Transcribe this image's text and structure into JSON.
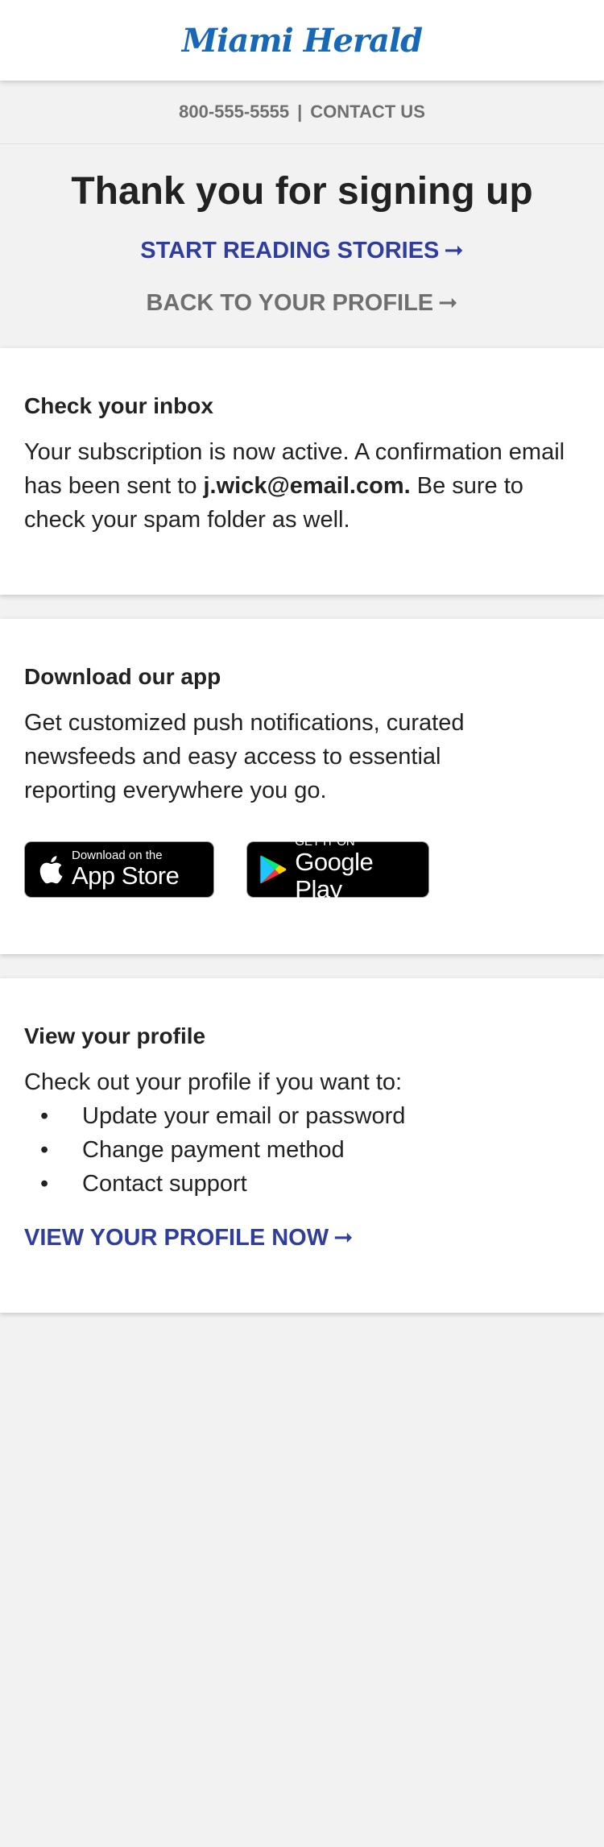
{
  "header": {
    "logo_text": "Miami Herald"
  },
  "contact": {
    "phone": "800-555-5555",
    "separator": "|",
    "contact_label": "CONTACT US"
  },
  "thanks": {
    "title": "Thank you for signing up",
    "start_reading": "START READING STORIES",
    "back_profile": "BACK TO YOUR PROFILE",
    "arrow": "➞"
  },
  "inbox": {
    "heading": "Check your inbox",
    "text_before": "Your subscription is now active. A confirmation email has been sent to ",
    "email": "j.wick@email.com.",
    "text_after": " Be sure to check your spam folder as well."
  },
  "app": {
    "heading": "Download our app",
    "text": "Get customized push notifications, curated newsfeeds and easy access to essential reporting everywhere you go.",
    "apple_small": "Download on the",
    "apple_big": "App Store",
    "google_small": "GET IT ON",
    "google_big": "Google Play"
  },
  "profile": {
    "heading": "View your profile",
    "intro": "Check out your profile if you want to:",
    "items": [
      "Update your email or password",
      "Change payment method",
      "Contact support"
    ],
    "cta": "VIEW YOUR PROFILE NOW",
    "arrow": "➞"
  },
  "colors": {
    "accent_blue": "#2f3d9c",
    "logo_blue": "#1868b8",
    "gray_text": "#6f6f6f"
  }
}
